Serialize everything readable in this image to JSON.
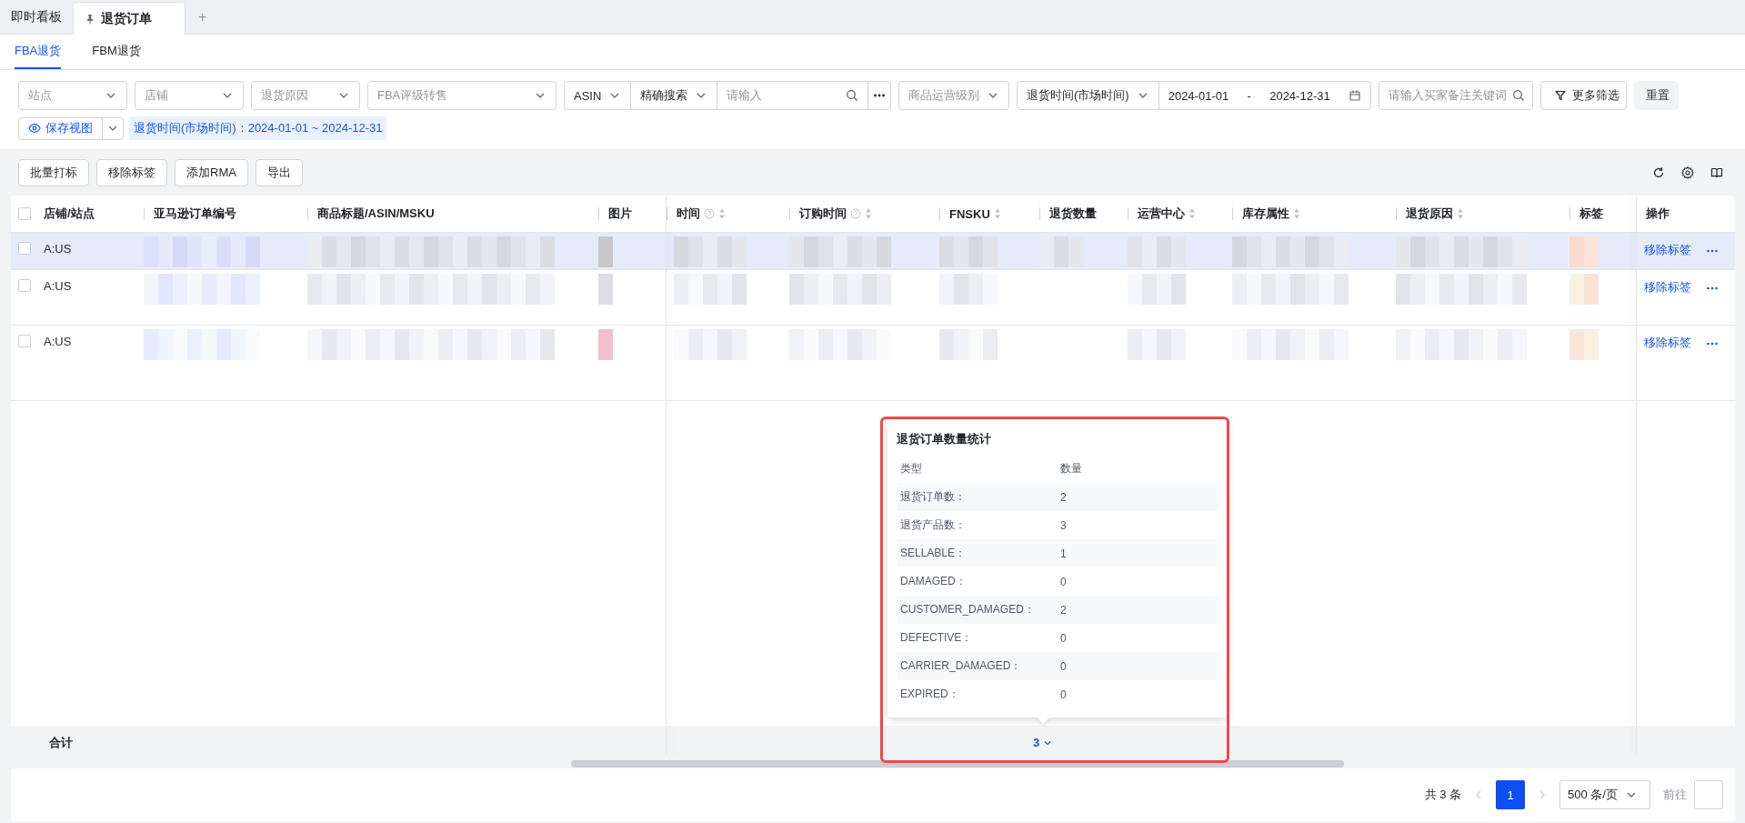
{
  "page_tabs": [
    {
      "label": "即时看板",
      "selected": false,
      "pinned": false
    },
    {
      "label": "退货订单",
      "selected": true,
      "pinned": true
    }
  ],
  "add_tab": "+",
  "sub_tabs": [
    {
      "label": "FBA退货",
      "selected": true
    },
    {
      "label": "FBM退货",
      "selected": false
    }
  ],
  "filters": [
    {
      "kind": "select",
      "placeholder": "站点"
    },
    {
      "kind": "select",
      "placeholder": "店铺"
    },
    {
      "kind": "select",
      "placeholder": "退货原因"
    },
    {
      "kind": "select",
      "placeholder": "FBA评级转售"
    },
    {
      "kind": "search-group",
      "field": "ASIN",
      "mode": "精确搜索",
      "placeholder": "请输入"
    },
    {
      "kind": "select",
      "placeholder": "商品运营级别"
    },
    {
      "kind": "date-range",
      "field": "退货时间(市场时间)",
      "start": "2024-01-01",
      "separator": "-",
      "end": "2024-12-31"
    },
    {
      "kind": "search",
      "placeholder": "请输入买家备注关键词"
    },
    {
      "kind": "filter-button",
      "label": "更多筛选"
    },
    {
      "kind": "plain-button",
      "label": "重置"
    }
  ],
  "save_view": {
    "label": "保存视图"
  },
  "active_filter": "退货时间(市场时间)：2024-01-01 ~ 2024-12-31",
  "actions": [
    "批量打标",
    "移除标签",
    "添加RMA",
    "导出"
  ],
  "table": {
    "select_all": {
      "checked": false
    },
    "columns": [
      {
        "label": "店铺/站点",
        "sortable": false,
        "help": false
      },
      {
        "label": "亚马逊订单编号",
        "sortable": false,
        "help": false
      },
      {
        "label": "商品标题/ASIN/MSKU",
        "sortable": false,
        "help": false
      },
      {
        "label": "图片",
        "sortable": false,
        "help": false
      },
      {
        "label": "时间",
        "sortable": true,
        "help": true
      },
      {
        "label": "订购时间",
        "sortable": true,
        "help": true
      },
      {
        "label": "FNSKU",
        "sortable": true,
        "help": false
      },
      {
        "label": "退货数量",
        "sortable": false,
        "help": false
      },
      {
        "label": "运营中心",
        "sortable": true,
        "help": false
      },
      {
        "label": "库存属性",
        "sortable": true,
        "help": false
      },
      {
        "label": "退货原因",
        "sortable": true,
        "help": false
      },
      {
        "label": "标签",
        "sortable": false,
        "help": false
      },
      {
        "label": "操作",
        "sortable": false,
        "help": false
      }
    ],
    "rows": [
      {
        "shop": "A:US",
        "checked": false,
        "highlighted": true,
        "action": "移除标签"
      },
      {
        "shop": "A:US",
        "checked": false,
        "highlighted": false,
        "action": "移除标签"
      },
      {
        "shop": "A:US",
        "checked": false,
        "highlighted": false,
        "action": "移除标签"
      }
    ],
    "footer": {
      "label": "合计",
      "total": "3"
    }
  },
  "stats_popover": {
    "title": "退货订单数量统计",
    "columns": [
      "类型",
      "数量"
    ],
    "rows": [
      {
        "type": "退货订单数：",
        "count": "2"
      },
      {
        "type": "退货产品数：",
        "count": "3"
      },
      {
        "type": "SELLABLE：",
        "count": "1"
      },
      {
        "type": "DAMAGED：",
        "count": "0"
      },
      {
        "type": "CUSTOMER_DAMAGED：",
        "count": "2"
      },
      {
        "type": "DEFECTIVE：",
        "count": "0"
      },
      {
        "type": "CARRIER_DAMAGED：",
        "count": "0"
      },
      {
        "type": "EXPIRED：",
        "count": "0"
      }
    ]
  },
  "pagination": {
    "total": "共 3 条",
    "pages": [
      {
        "label": "1",
        "selected": true
      }
    ],
    "page_size": "500 条/页",
    "goto": "前往"
  }
}
